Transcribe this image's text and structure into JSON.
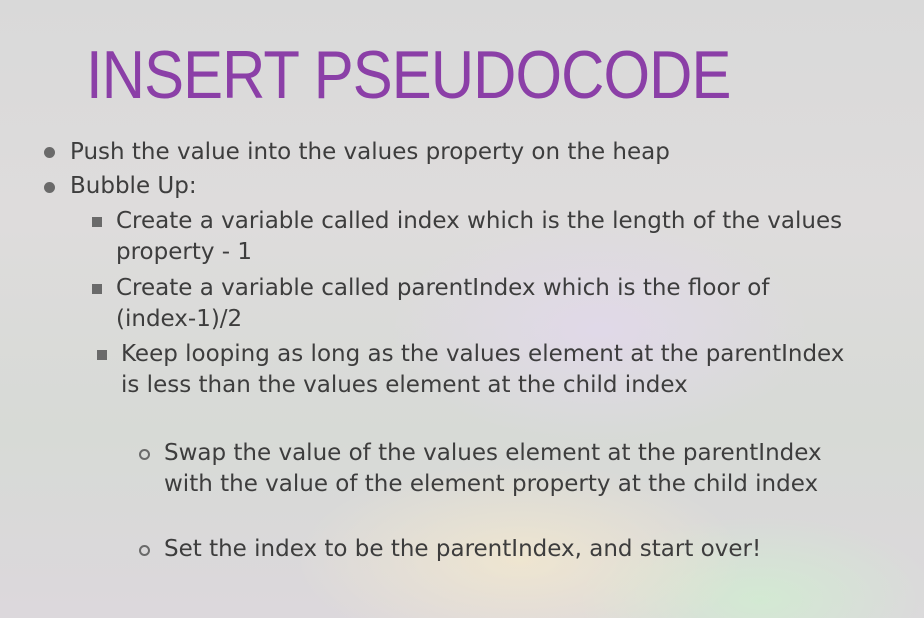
{
  "slide": {
    "title": "INSERT PSEUDOCODE",
    "bullets": [
      {
        "text": "Push the value into the values property on the heap"
      },
      {
        "text": "Bubble Up:"
      }
    ],
    "sub_bullets": [
      {
        "text": "Create a variable called index which is the length of the values property - 1"
      },
      {
        "text": "Create a variable called parentIndex which is the floor of (index-1)/2"
      },
      {
        "text": "Keep looping as long as the values element at the parentIndex is less than the values element at the child index"
      }
    ],
    "sub_sub_bullets": [
      {
        "text": "Swap the value of the values element at the parentIndex with the value of the element property at the child index"
      },
      {
        "text": "Set the index to be the parentIndex, and start over!"
      }
    ],
    "colors": {
      "title": "#8b3fa7",
      "text": "#3d3d3d",
      "bullet": "#6a6a6a"
    }
  }
}
